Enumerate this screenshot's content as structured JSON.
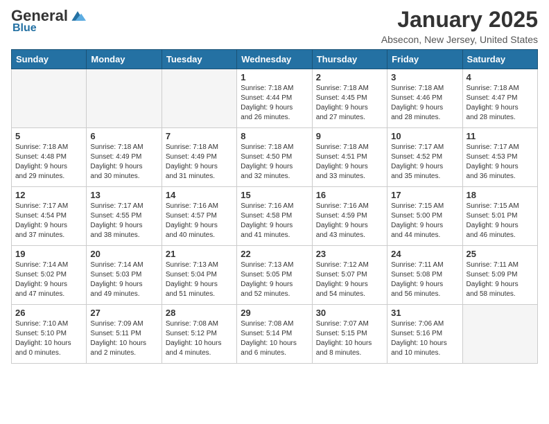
{
  "logo": {
    "general": "General",
    "blue": "Blue"
  },
  "header": {
    "month": "January 2025",
    "location": "Absecon, New Jersey, United States"
  },
  "weekdays": [
    "Sunday",
    "Monday",
    "Tuesday",
    "Wednesday",
    "Thursday",
    "Friday",
    "Saturday"
  ],
  "weeks": [
    [
      {
        "day": "",
        "info": ""
      },
      {
        "day": "",
        "info": ""
      },
      {
        "day": "",
        "info": ""
      },
      {
        "day": "1",
        "info": "Sunrise: 7:18 AM\nSunset: 4:44 PM\nDaylight: 9 hours\nand 26 minutes."
      },
      {
        "day": "2",
        "info": "Sunrise: 7:18 AM\nSunset: 4:45 PM\nDaylight: 9 hours\nand 27 minutes."
      },
      {
        "day": "3",
        "info": "Sunrise: 7:18 AM\nSunset: 4:46 PM\nDaylight: 9 hours\nand 28 minutes."
      },
      {
        "day": "4",
        "info": "Sunrise: 7:18 AM\nSunset: 4:47 PM\nDaylight: 9 hours\nand 28 minutes."
      }
    ],
    [
      {
        "day": "5",
        "info": "Sunrise: 7:18 AM\nSunset: 4:48 PM\nDaylight: 9 hours\nand 29 minutes."
      },
      {
        "day": "6",
        "info": "Sunrise: 7:18 AM\nSunset: 4:49 PM\nDaylight: 9 hours\nand 30 minutes."
      },
      {
        "day": "7",
        "info": "Sunrise: 7:18 AM\nSunset: 4:49 PM\nDaylight: 9 hours\nand 31 minutes."
      },
      {
        "day": "8",
        "info": "Sunrise: 7:18 AM\nSunset: 4:50 PM\nDaylight: 9 hours\nand 32 minutes."
      },
      {
        "day": "9",
        "info": "Sunrise: 7:18 AM\nSunset: 4:51 PM\nDaylight: 9 hours\nand 33 minutes."
      },
      {
        "day": "10",
        "info": "Sunrise: 7:17 AM\nSunset: 4:52 PM\nDaylight: 9 hours\nand 35 minutes."
      },
      {
        "day": "11",
        "info": "Sunrise: 7:17 AM\nSunset: 4:53 PM\nDaylight: 9 hours\nand 36 minutes."
      }
    ],
    [
      {
        "day": "12",
        "info": "Sunrise: 7:17 AM\nSunset: 4:54 PM\nDaylight: 9 hours\nand 37 minutes."
      },
      {
        "day": "13",
        "info": "Sunrise: 7:17 AM\nSunset: 4:55 PM\nDaylight: 9 hours\nand 38 minutes."
      },
      {
        "day": "14",
        "info": "Sunrise: 7:16 AM\nSunset: 4:57 PM\nDaylight: 9 hours\nand 40 minutes."
      },
      {
        "day": "15",
        "info": "Sunrise: 7:16 AM\nSunset: 4:58 PM\nDaylight: 9 hours\nand 41 minutes."
      },
      {
        "day": "16",
        "info": "Sunrise: 7:16 AM\nSunset: 4:59 PM\nDaylight: 9 hours\nand 43 minutes."
      },
      {
        "day": "17",
        "info": "Sunrise: 7:15 AM\nSunset: 5:00 PM\nDaylight: 9 hours\nand 44 minutes."
      },
      {
        "day": "18",
        "info": "Sunrise: 7:15 AM\nSunset: 5:01 PM\nDaylight: 9 hours\nand 46 minutes."
      }
    ],
    [
      {
        "day": "19",
        "info": "Sunrise: 7:14 AM\nSunset: 5:02 PM\nDaylight: 9 hours\nand 47 minutes."
      },
      {
        "day": "20",
        "info": "Sunrise: 7:14 AM\nSunset: 5:03 PM\nDaylight: 9 hours\nand 49 minutes."
      },
      {
        "day": "21",
        "info": "Sunrise: 7:13 AM\nSunset: 5:04 PM\nDaylight: 9 hours\nand 51 minutes."
      },
      {
        "day": "22",
        "info": "Sunrise: 7:13 AM\nSunset: 5:05 PM\nDaylight: 9 hours\nand 52 minutes."
      },
      {
        "day": "23",
        "info": "Sunrise: 7:12 AM\nSunset: 5:07 PM\nDaylight: 9 hours\nand 54 minutes."
      },
      {
        "day": "24",
        "info": "Sunrise: 7:11 AM\nSunset: 5:08 PM\nDaylight: 9 hours\nand 56 minutes."
      },
      {
        "day": "25",
        "info": "Sunrise: 7:11 AM\nSunset: 5:09 PM\nDaylight: 9 hours\nand 58 minutes."
      }
    ],
    [
      {
        "day": "26",
        "info": "Sunrise: 7:10 AM\nSunset: 5:10 PM\nDaylight: 10 hours\nand 0 minutes."
      },
      {
        "day": "27",
        "info": "Sunrise: 7:09 AM\nSunset: 5:11 PM\nDaylight: 10 hours\nand 2 minutes."
      },
      {
        "day": "28",
        "info": "Sunrise: 7:08 AM\nSunset: 5:12 PM\nDaylight: 10 hours\nand 4 minutes."
      },
      {
        "day": "29",
        "info": "Sunrise: 7:08 AM\nSunset: 5:14 PM\nDaylight: 10 hours\nand 6 minutes."
      },
      {
        "day": "30",
        "info": "Sunrise: 7:07 AM\nSunset: 5:15 PM\nDaylight: 10 hours\nand 8 minutes."
      },
      {
        "day": "31",
        "info": "Sunrise: 7:06 AM\nSunset: 5:16 PM\nDaylight: 10 hours\nand 10 minutes."
      },
      {
        "day": "",
        "info": ""
      }
    ]
  ]
}
